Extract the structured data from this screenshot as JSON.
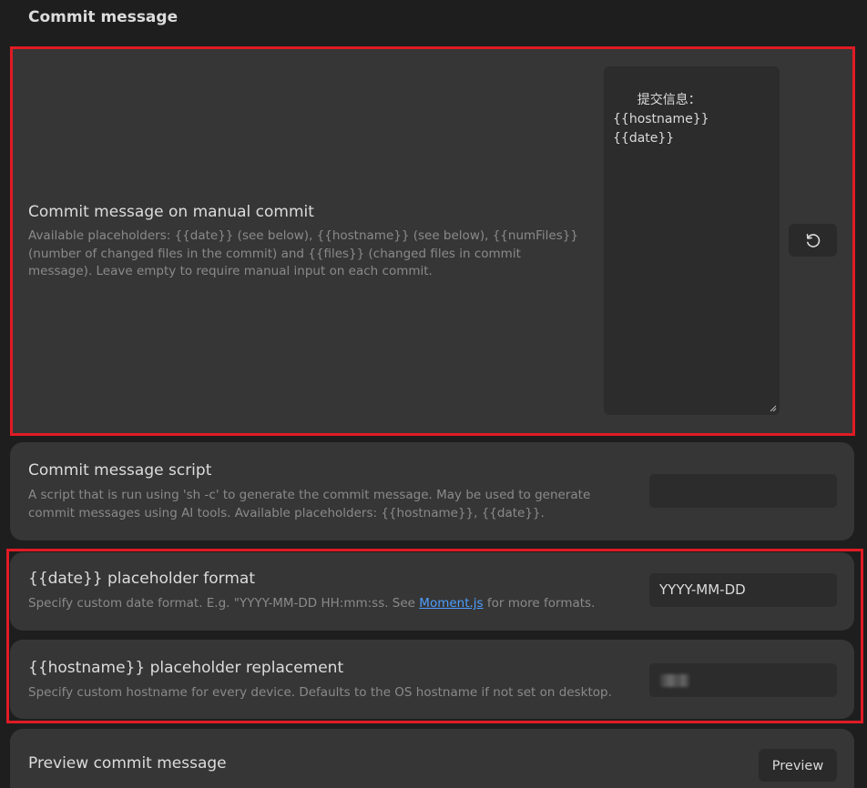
{
  "section": {
    "heading": "Commit message"
  },
  "manual_commit": {
    "title": "Commit message on manual commit",
    "description": "Available placeholders: {{date}} (see below), {{hostname}} (see below), {{numFiles}} (number of changed files in the commit) and {{files}} (changed files in commit message). Leave empty to require manual input on each commit.",
    "value": "提交信息：\n{{hostname}} {{date}}",
    "reset_icon": "reset-icon"
  },
  "script": {
    "title": "Commit message script",
    "description": "A script that is run using 'sh -c' to generate the commit message. May be used to generate commit messages using AI tools. Available placeholders: {{hostname}}, {{date}}.",
    "value": ""
  },
  "date_format": {
    "title": "{{date}} placeholder format",
    "description_before": "Specify custom date format. E.g. \"YYYY-MM-DD HH:mm:ss. See ",
    "link_text": "Moment.js",
    "description_after": " for more formats.",
    "value": "YYYY-MM-DD"
  },
  "hostname": {
    "title": "{{hostname}} placeholder replacement",
    "description": "Specify custom hostname for every device. Defaults to the OS hostname if not set on desktop."
  },
  "preview": {
    "title": "Preview commit message",
    "button_label": "Preview"
  },
  "colors": {
    "background": "#1e1e1e",
    "card": "#363636",
    "input": "#2c2c2c",
    "highlight": "#e01b24",
    "link": "#4e9eff"
  }
}
